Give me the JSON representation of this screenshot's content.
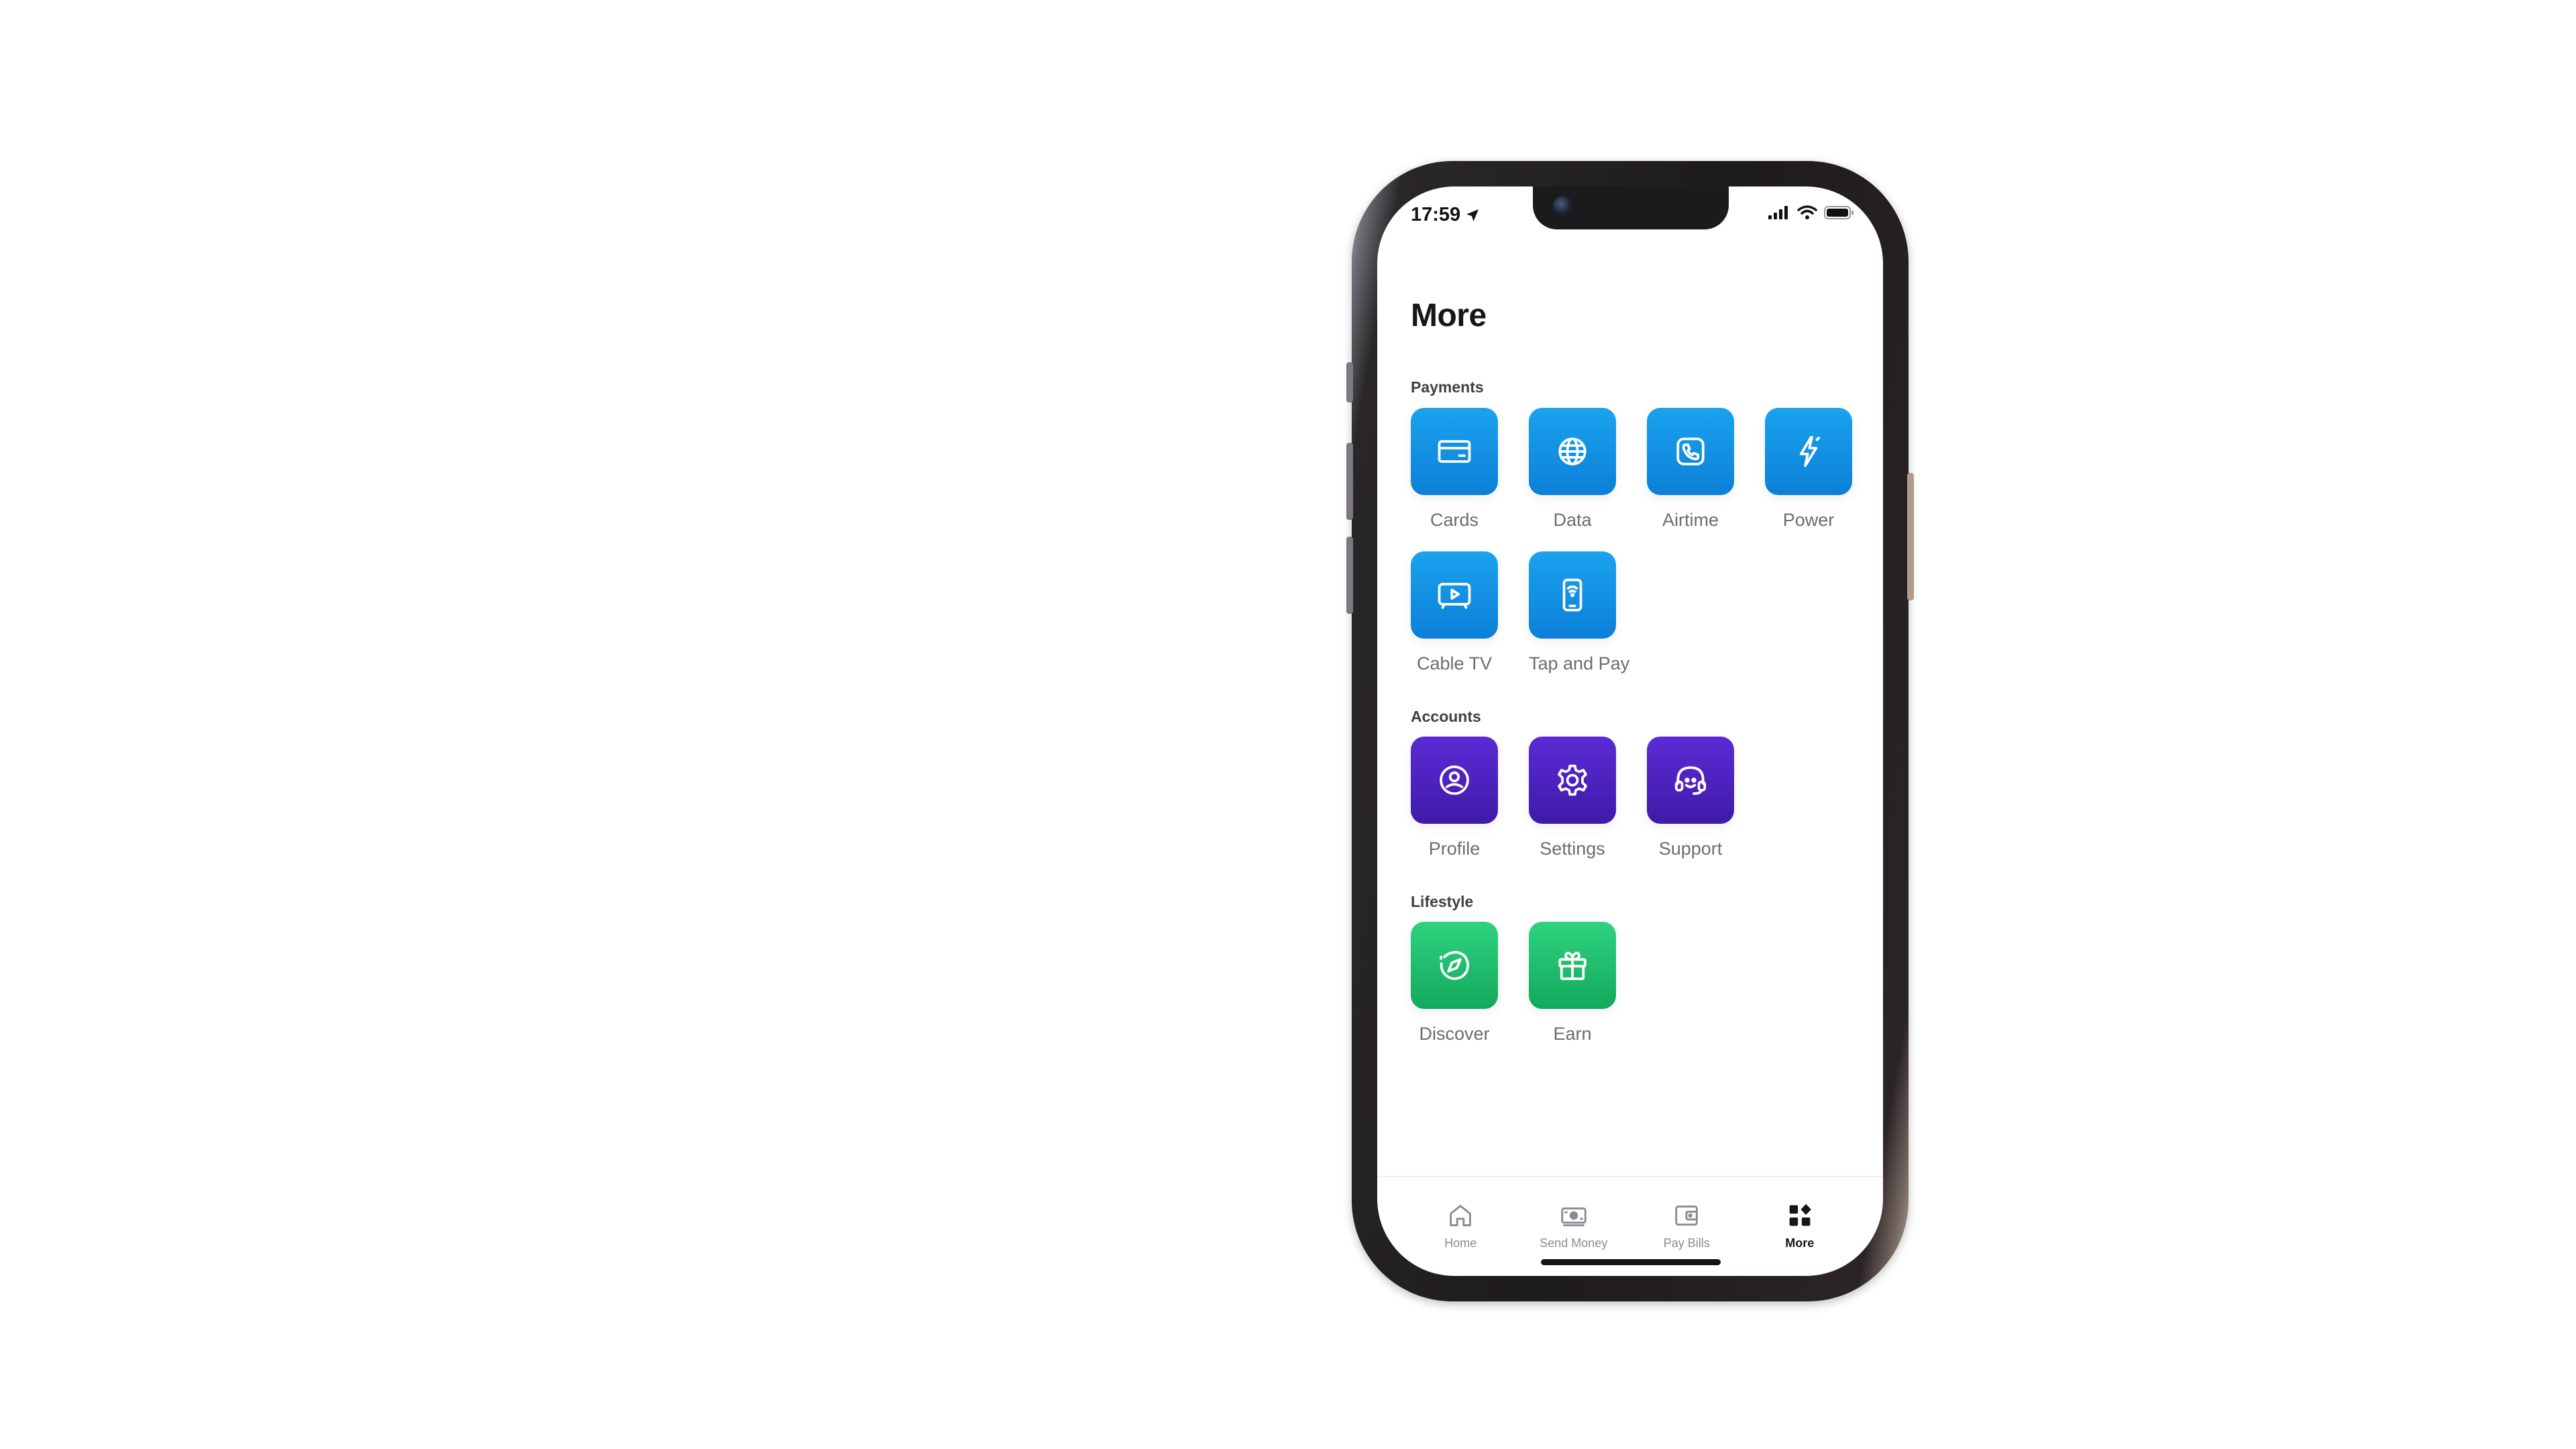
{
  "status_bar": {
    "time": "17:59",
    "icons": [
      "location-arrow-icon",
      "cellular-signal-icon",
      "wifi-icon",
      "battery-icon"
    ]
  },
  "page": {
    "title": "More"
  },
  "sections": {
    "payments": {
      "label": "Payments",
      "color": "#0c8fe0",
      "items": [
        {
          "label": "Cards",
          "icon": "card-icon"
        },
        {
          "label": "Data",
          "icon": "globe-icon"
        },
        {
          "label": "Airtime",
          "icon": "phone-call-icon"
        },
        {
          "label": "Power",
          "icon": "lightning-icon"
        },
        {
          "label": "Cable TV",
          "icon": "tv-icon"
        },
        {
          "label": "Tap and Pay",
          "icon": "contactless-phone-icon"
        }
      ]
    },
    "accounts": {
      "label": "Accounts",
      "color": "#4a21be",
      "items": [
        {
          "label": "Profile",
          "icon": "user-circle-icon"
        },
        {
          "label": "Settings",
          "icon": "gear-icon"
        },
        {
          "label": "Support",
          "icon": "headset-icon"
        }
      ]
    },
    "lifestyle": {
      "label": "Lifestyle",
      "color": "#1cbf6d",
      "items": [
        {
          "label": "Discover",
          "icon": "compass-icon"
        },
        {
          "label": "Earn",
          "icon": "gift-icon"
        }
      ]
    }
  },
  "bottom_nav": {
    "items": [
      {
        "label": "Home",
        "icon": "home-icon",
        "active": false
      },
      {
        "label": "Send Money",
        "icon": "money-icon",
        "active": false
      },
      {
        "label": "Pay Bills",
        "icon": "wallet-icon",
        "active": false
      },
      {
        "label": "More",
        "icon": "grid-icon",
        "active": true
      }
    ]
  }
}
